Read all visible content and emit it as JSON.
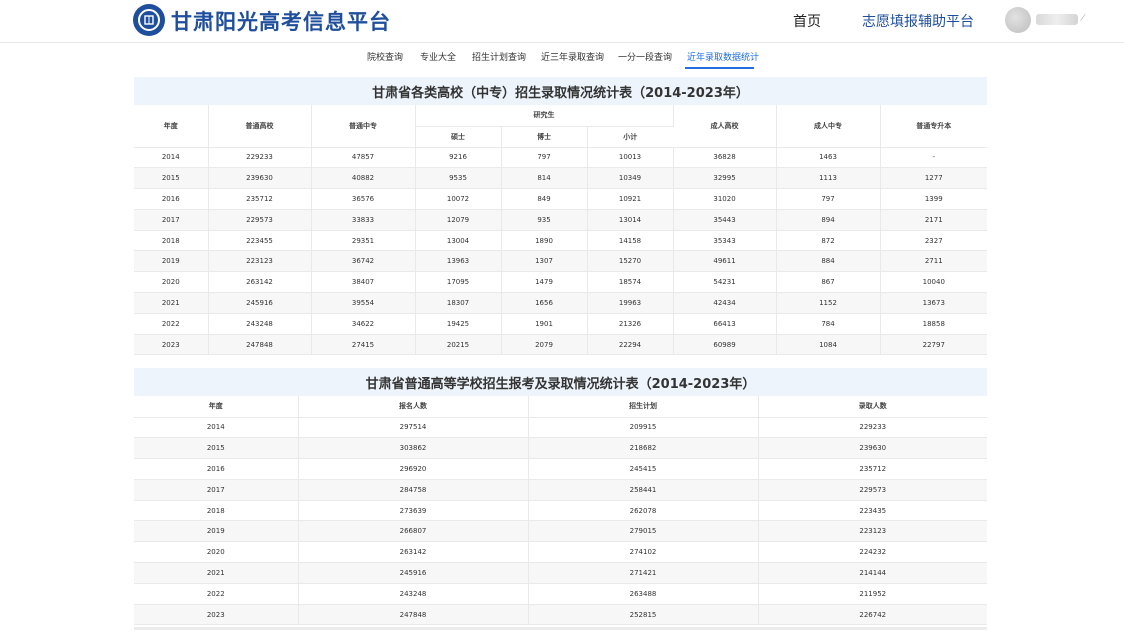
{
  "header": {
    "site_title": "甘肃阳光高考信息平台",
    "nav_home": "首页",
    "nav_aux": "志愿填报辅助平台"
  },
  "tabs": [
    {
      "label": "院校查询",
      "active": false
    },
    {
      "label": "专业大全",
      "active": false
    },
    {
      "label": "招生计划查询",
      "active": false
    },
    {
      "label": "近三年录取查询",
      "active": false
    },
    {
      "label": "一分一段查询",
      "active": false
    },
    {
      "label": "近年录取数据统计",
      "active": true
    }
  ],
  "colors": {
    "brand": "#1f4e9c",
    "active_tab": "#1f6fe0",
    "panel_header_bg": "#eef4fb"
  },
  "table1": {
    "title": "甘肃省各类高校（中专）招生录取情况统计表（2014-2023年）",
    "headers": {
      "year": "年度",
      "regular_college": "普通高校",
      "regular_secondary": "普通中专",
      "graduate": "研究生",
      "master": "硕士",
      "doctor": "博士",
      "subtotal": "小计",
      "adult_college": "成人高校",
      "adult_secondary": "成人中专",
      "upgrade": "普通专升本"
    },
    "rows": [
      [
        "2014",
        "229233",
        "47857",
        "9216",
        "797",
        "10013",
        "36828",
        "1463",
        "-"
      ],
      [
        "2015",
        "239630",
        "40882",
        "9535",
        "814",
        "10349",
        "32995",
        "1113",
        "1277"
      ],
      [
        "2016",
        "235712",
        "36576",
        "10072",
        "849",
        "10921",
        "31020",
        "797",
        "1399"
      ],
      [
        "2017",
        "229573",
        "33833",
        "12079",
        "935",
        "13014",
        "35443",
        "894",
        "2171"
      ],
      [
        "2018",
        "223455",
        "29351",
        "13004",
        "1890",
        "14158",
        "35343",
        "872",
        "2327"
      ],
      [
        "2019",
        "223123",
        "36742",
        "13963",
        "1307",
        "15270",
        "49611",
        "884",
        "2711"
      ],
      [
        "2020",
        "263142",
        "38407",
        "17095",
        "1479",
        "18574",
        "54231",
        "867",
        "10040"
      ],
      [
        "2021",
        "245916",
        "39554",
        "18307",
        "1656",
        "19963",
        "42434",
        "1152",
        "13673"
      ],
      [
        "2022",
        "243248",
        "34622",
        "19425",
        "1901",
        "21326",
        "66413",
        "784",
        "18858"
      ],
      [
        "2023",
        "247848",
        "27415",
        "20215",
        "2079",
        "22294",
        "60989",
        "1084",
        "22797"
      ]
    ]
  },
  "table2": {
    "title": "甘肃省普通高等学校招生报考及录取情况统计表（2014-2023年）",
    "headers": [
      "年度",
      "报名人数",
      "招生计划",
      "录取人数"
    ],
    "rows": [
      [
        "2014",
        "297514",
        "209915",
        "229233"
      ],
      [
        "2015",
        "303862",
        "218682",
        "239630"
      ],
      [
        "2016",
        "296920",
        "245415",
        "235712"
      ],
      [
        "2017",
        "284758",
        "258441",
        "229573"
      ],
      [
        "2018",
        "273639",
        "262078",
        "223435"
      ],
      [
        "2019",
        "266807",
        "279015",
        "223123"
      ],
      [
        "2020",
        "263142",
        "274102",
        "224232"
      ],
      [
        "2021",
        "245916",
        "271421",
        "214144"
      ],
      [
        "2022",
        "243248",
        "263488",
        "211952"
      ],
      [
        "2023",
        "247848",
        "252815",
        "226742"
      ]
    ]
  }
}
